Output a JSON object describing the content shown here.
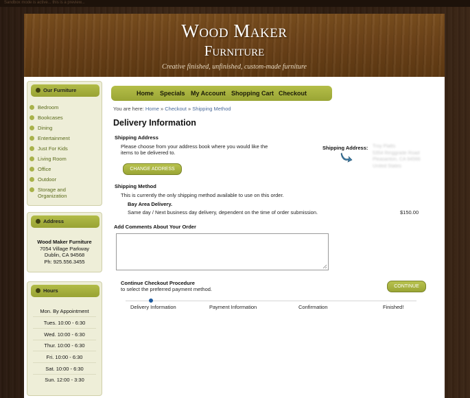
{
  "top_note": "Sandbox mode is active... this is a preview...",
  "site": {
    "title_line1": "Wood Maker",
    "title_line2": "Furniture",
    "tagline": "Creative finished, unfinished, custom-made furniture"
  },
  "sidebar": {
    "furniture": {
      "title": "Our Furniture",
      "items": [
        "Bedroom",
        "Bookcases",
        "Dining",
        "Entertainment",
        "Just For Kids",
        "Living Room",
        "Office",
        "Outdoor",
        "Storage and",
        "Organization"
      ]
    },
    "address": {
      "title": "Address",
      "name": "Wood Maker Furniture",
      "street": "7054 Village Parkway",
      "city": "Dublin, CA 94568",
      "phone": "Ph: 925.556.3455"
    },
    "hours": {
      "title": "Hours",
      "lines": [
        "Mon. By Appointment",
        "Tues. 10:00 - 6:30",
        "Wed. 10:00 - 6:30",
        "Thur. 10:00 - 6:30",
        "Fri. 10:00 - 6:30",
        "Sat. 10:00 - 6:30",
        "Sun. 12:00 - 3:30"
      ]
    }
  },
  "nav": {
    "home": "Home",
    "specials": "Specials",
    "account": "My Account",
    "cart": "Shopping Cart",
    "checkout": "Checkout"
  },
  "breadcrumb": {
    "prefix": "You are here:",
    "home": "Home",
    "checkout": "Checkout",
    "shipping": "Shipping Method",
    "sep": "»"
  },
  "main": {
    "heading": "Delivery Information",
    "shipping_address": {
      "title": "Shipping Address",
      "instructions_l1": "Please choose from your address book where you would like the",
      "instructions_l2": "items to be delivered to.",
      "change_button": "CHANGE ADDRESS",
      "label": "Shipping Address:",
      "blurred_l1": "Troy Platts",
      "blurred_l2": "5354 Ringgrade Road",
      "blurred_l3": "Pleasanton, CA 94566",
      "blurred_l4": "United States"
    },
    "shipping_method": {
      "title": "Shipping Method",
      "note": "This is currently the only shipping method available to use on this order.",
      "option_name": "Bay Area Delivery.",
      "option_desc": "Same day / Next business day delivery, dependent on the time of order submission.",
      "price": "$150.00"
    },
    "comments": {
      "title": "Add Comments About Your Order",
      "value": ""
    },
    "continue": {
      "title": "Continue Checkout Procedure",
      "subtitle": "to select the preferred payment method.",
      "button": "CONTINUE"
    },
    "steps": [
      "Delivery Information",
      "Payment Information",
      "Confirmation",
      "Finished!"
    ]
  },
  "colors": {
    "accent_green": "#a3ad3e",
    "link": "#4a6a9a",
    "progress_dot": "#1e5a9e"
  }
}
